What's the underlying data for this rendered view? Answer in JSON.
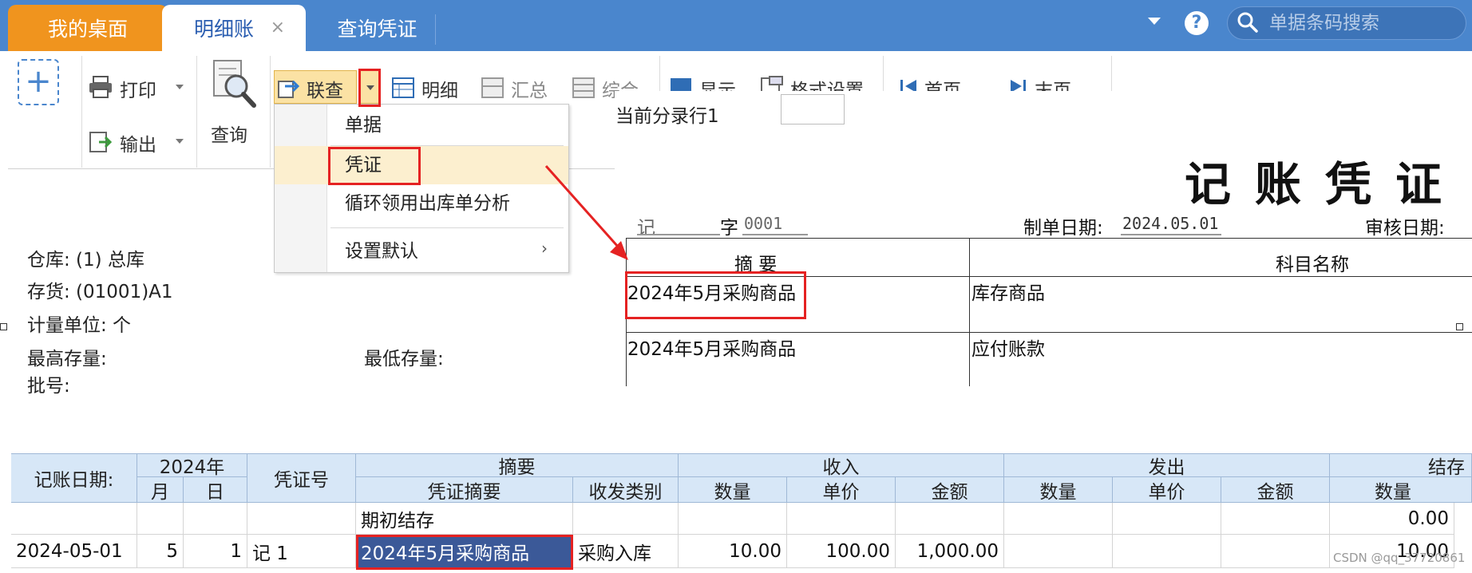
{
  "tabs": {
    "desktop": "我的桌面",
    "ledger": "明细账",
    "voucher_query": "查询凭证",
    "close_glyph": "×"
  },
  "header": {
    "help": "?",
    "search_placeholder": "单据条码搜索"
  },
  "toolbar": {
    "add": "+",
    "print": "打印",
    "export": "输出",
    "query": "查询",
    "linked_query": "联查",
    "detail": "明细",
    "summary": "汇总",
    "composite": "综合",
    "display": "显示",
    "format_settings": "格式设置",
    "first_page": "首页",
    "last_page": "末页"
  },
  "menu": {
    "items": [
      "单据",
      "凭证",
      "循环领用出库单分析",
      "设置默认"
    ],
    "submenu_arrow": "›"
  },
  "current_entry_label": "当前分录行1",
  "info": {
    "warehouse": "仓库: (1) 总库",
    "inventory": "存货: (01001)A1",
    "unit": "计量单位: 个",
    "max_stock": "最高存量:",
    "min_stock": "最低存量:",
    "batch": "批号:"
  },
  "voucher": {
    "title": "记账凭证",
    "type_char": "记",
    "zi": "字",
    "number": "0001",
    "date_label": "制单日期:",
    "date": "2024.05.01",
    "audit_label": "审核日期:",
    "col_summary": "摘 要",
    "col_account": "科目名称",
    "rows": [
      {
        "summary": "2024年5月采购商品",
        "account": "库存商品"
      },
      {
        "summary": "2024年5月采购商品",
        "account": "应付账款"
      }
    ]
  },
  "grid": {
    "headers": {
      "date": "记账日期:",
      "year": "2024年",
      "month": "月",
      "day": "日",
      "voucher_no": "凭证号",
      "summary_group": "摘要",
      "voucher_summary": "凭证摘要",
      "category": "收发类别",
      "income": "收入",
      "outgo": "发出",
      "balance": "结存",
      "qty": "数量",
      "price": "单价",
      "amount": "金额"
    },
    "rows": [
      {
        "date": "",
        "month": "",
        "day": "",
        "vno": "",
        "summary": "期初结存",
        "category": "",
        "in_qty": "",
        "in_price": "",
        "in_amount": "",
        "out_qty": "",
        "out_price": "",
        "out_amount": "",
        "bal_qty": "0.00"
      },
      {
        "date": "2024-05-01",
        "month": "5",
        "day": "1",
        "vno": "记 1",
        "summary": "2024年5月采购商品",
        "category": "采购入库",
        "in_qty": "10.00",
        "in_price": "100.00",
        "in_amount": "1,000.00",
        "out_qty": "",
        "out_price": "",
        "out_amount": "",
        "bal_qty": "10.00"
      }
    ]
  },
  "watermark": "CSDN @qq_37720861"
}
